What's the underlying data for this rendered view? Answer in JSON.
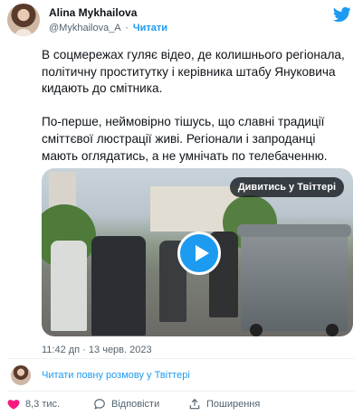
{
  "author": {
    "name": "Alina Mykhailova",
    "handle": "@Mykhailova_A",
    "separator": "·",
    "follow_label": "Читати"
  },
  "tweet": {
    "text": "В соцмережах гуляє відео, де колишнього регіонала, політичну проститутку і керівника штабу Януковича кидають до смітника.\n\nПо-перше, неймовірно тішусь, що славні традиції сміттєвої люстрації живі. Регіонали і запроданці мають оглядатись, а не умнічать по телебаченню."
  },
  "media": {
    "watch_label": "Дивитись у Твіттері",
    "play_icon": "play-icon"
  },
  "timestamp": "11:42 дп · 13 черв. 2023",
  "read_more": {
    "label": "Читати повну розмову у Твіттері"
  },
  "actions": {
    "likes_count": "8,3 тис.",
    "reply_label": "Відповісти",
    "share_label": "Поширення"
  },
  "colors": {
    "accent": "#1d9bf0",
    "like": "#f91880",
    "muted": "#536471",
    "text": "#0f1419"
  }
}
